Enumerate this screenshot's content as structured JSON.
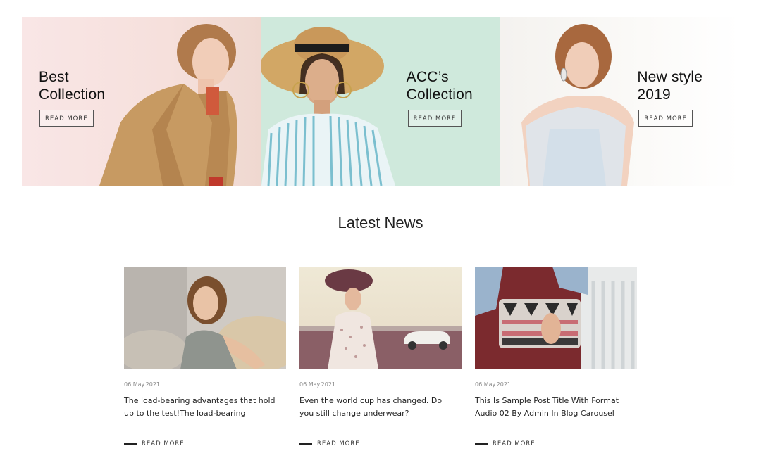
{
  "banners": [
    {
      "title_line1": "Best",
      "title_line2": "Collection",
      "button": "READ MORE"
    },
    {
      "title_line1": "ACC’s",
      "title_line2": "Collection",
      "button": "READ MORE"
    },
    {
      "title_line1": "New style",
      "title_line2": "2019",
      "button": "READ MORE"
    }
  ],
  "latest_news": {
    "title": "Latest News",
    "posts": [
      {
        "date": "06.May.2021",
        "text": "The load-bearing advantages that hold up to the test!The load-bearing",
        "read_more": "READ MORE"
      },
      {
        "date": "06.May.2021",
        "text": "Even the world cup has changed. Do you still change underwear?",
        "read_more": "READ MORE"
      },
      {
        "date": "06.May.2021",
        "text": "This Is Sample Post Title With Format Audio 02 By Admin In Blog Carousel",
        "read_more": "READ MORE"
      }
    ]
  }
}
